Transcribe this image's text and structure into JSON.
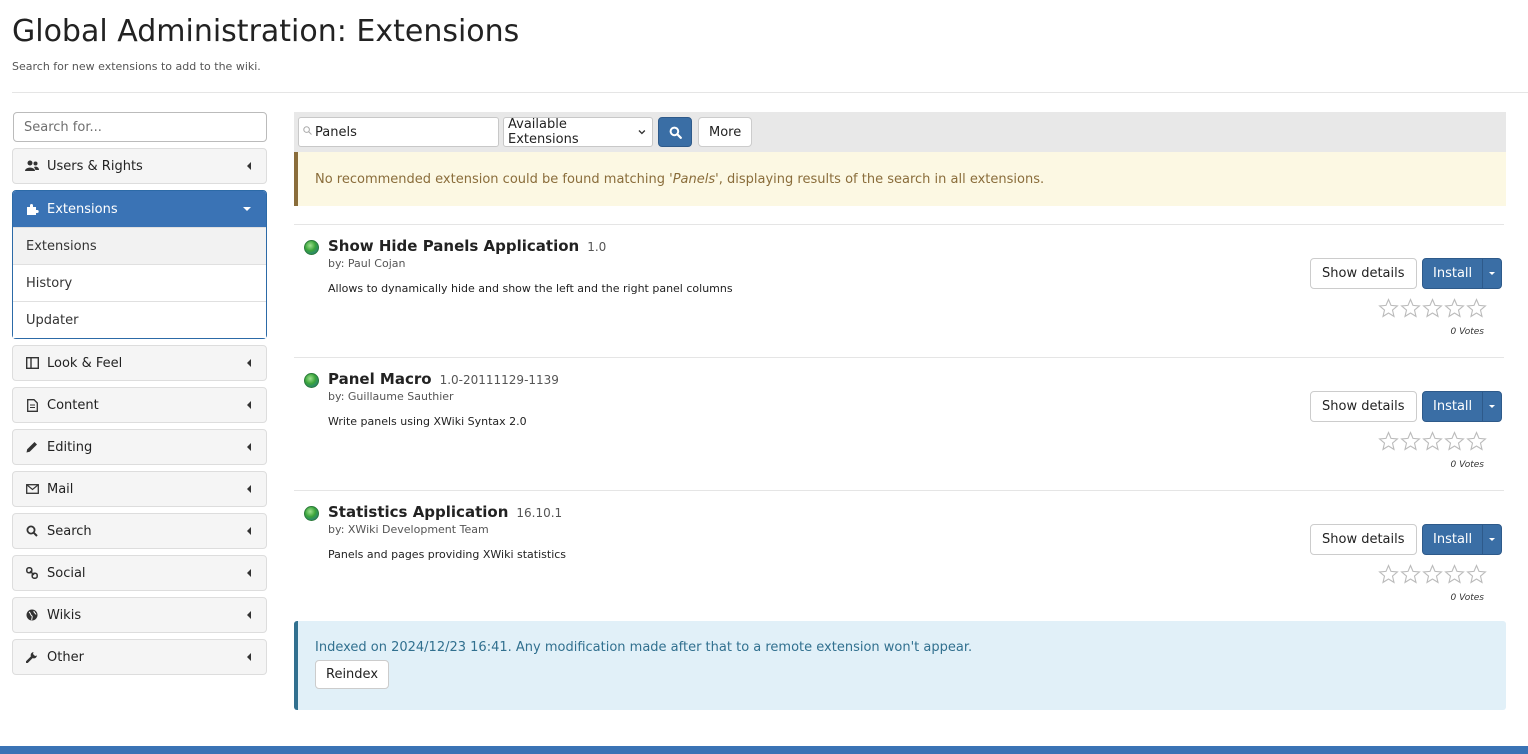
{
  "page": {
    "title": "Global Administration: Extensions",
    "hint": "Search for new extensions to add to the wiki."
  },
  "sidebar": {
    "search_placeholder": "Search for...",
    "sections": [
      {
        "label": "Users & Rights",
        "icon": "users-icon"
      },
      {
        "label": "Extensions",
        "icon": "puzzle-icon",
        "active": true,
        "items": [
          {
            "label": "Extensions",
            "selected": true
          },
          {
            "label": "History"
          },
          {
            "label": "Updater"
          }
        ]
      },
      {
        "label": "Look & Feel",
        "icon": "layout-icon"
      },
      {
        "label": "Content",
        "icon": "document-icon"
      },
      {
        "label": "Editing",
        "icon": "pencil-icon"
      },
      {
        "label": "Mail",
        "icon": "envelope-icon"
      },
      {
        "label": "Search",
        "icon": "search-icon"
      },
      {
        "label": "Social",
        "icon": "link-icon"
      },
      {
        "label": "Wikis",
        "icon": "globe-icon"
      },
      {
        "label": "Other",
        "icon": "wrench-icon"
      }
    ]
  },
  "toolbar": {
    "search_value": "Panels",
    "repository_select": "Available Extensions",
    "more_label": "More"
  },
  "warning": {
    "prefix": "No recommended extension could be found matching '",
    "query": "Panels",
    "suffix": "', displaying results of the search in all extensions."
  },
  "extensions": [
    {
      "name": "Show Hide Panels Application",
      "version": "1.0",
      "author": "by: Paul Cojan",
      "description": "Allows to dynamically hide and show the left and the right panel columns",
      "show_details_label": "Show details",
      "install_label": "Install",
      "rating": 0,
      "votes": "0 Votes"
    },
    {
      "name": "Panel Macro",
      "version": "1.0-20111129-1139",
      "author": "by: Guillaume Sauthier",
      "description": "Write panels using XWiki Syntax 2.0",
      "show_details_label": "Show details",
      "install_label": "Install",
      "rating": 0,
      "votes": "0 Votes"
    },
    {
      "name": "Statistics Application",
      "version": "16.10.1",
      "author": "by: XWiki Development Team",
      "description": "Panels and pages providing XWiki statistics",
      "show_details_label": "Show details",
      "install_label": "Install",
      "rating": 0,
      "votes": "0 Votes"
    }
  ],
  "info": {
    "text": "Indexed on 2024/12/23 16:41. Any modification made after that to a remote extension won't appear.",
    "reindex_label": "Reindex"
  },
  "colors": {
    "accent": "#3a73b5",
    "warning_bg": "#fcf8e3",
    "warning_text": "#8a6d3b",
    "info_bg": "#e1f0f8",
    "info_text": "#31708f"
  }
}
